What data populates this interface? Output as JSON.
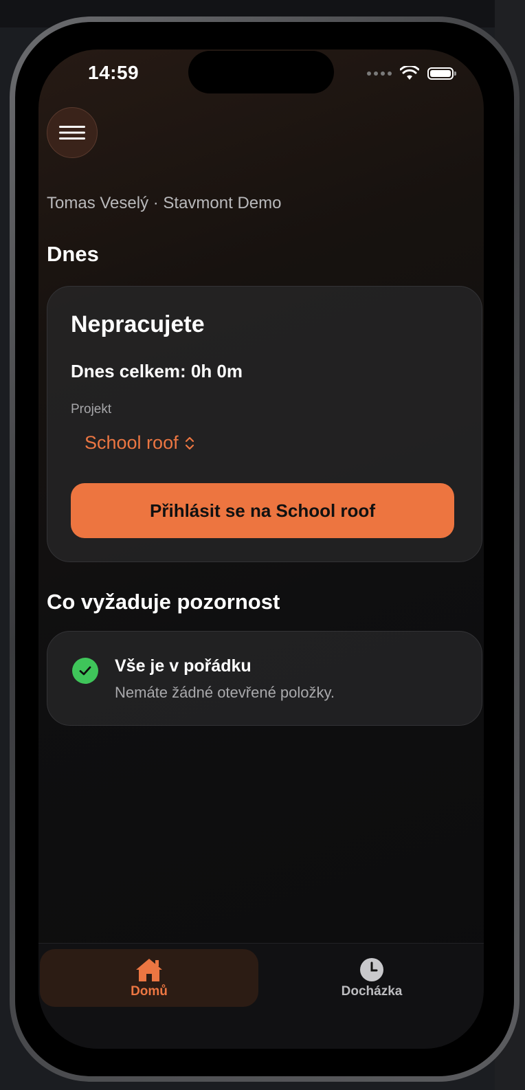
{
  "status_bar": {
    "time": "14:59"
  },
  "header": {
    "menu_icon": "hamburger-menu-icon",
    "user_line": "Tomas Veselý · Stavmont Demo"
  },
  "today": {
    "section_title": "Dnes",
    "status": "Nepracujete",
    "total": "Dnes celkem: 0h 0m",
    "project_label": "Projekt",
    "project_value": "School roof",
    "checkin_button": "Přihlásit se na School roof"
  },
  "attention": {
    "section_title": "Co vyžaduje pozornost",
    "item_title": "Vše je v pořádku",
    "item_subtitle": "Nemáte žádné otevřené položky."
  },
  "tabs": [
    {
      "label": "Domů",
      "icon": "house-icon",
      "active": true
    },
    {
      "label": "Docházka",
      "icon": "clock-icon",
      "active": false
    }
  ],
  "colors": {
    "accent": "#ed7540",
    "success": "#3fc55a",
    "background": "#0f0f10"
  }
}
